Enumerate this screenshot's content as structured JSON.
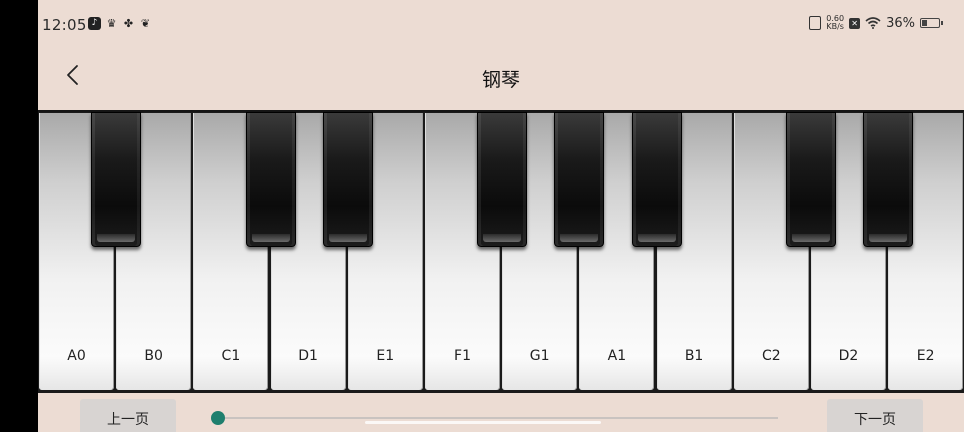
{
  "status_bar": {
    "time": "12:05",
    "left_icons": [
      "tiktok-icon",
      "crown-icon",
      "fan-icon",
      "leaf-icon"
    ],
    "net_speed_value": "0.60",
    "net_speed_unit": "KB/s",
    "battery_text": "36%",
    "battery_level": 0.36
  },
  "header": {
    "title": "钢琴"
  },
  "keyboard": {
    "white_keys": [
      {
        "label": "A0"
      },
      {
        "label": "B0"
      },
      {
        "label": "C1"
      },
      {
        "label": "D1"
      },
      {
        "label": "E1"
      },
      {
        "label": "F1"
      },
      {
        "label": "G1"
      },
      {
        "label": "A1"
      },
      {
        "label": "B1"
      },
      {
        "label": "C2"
      },
      {
        "label": "D2"
      },
      {
        "label": "E2"
      }
    ],
    "black_key_after_white_index": [
      0,
      2,
      3,
      5,
      6,
      7,
      9,
      10
    ]
  },
  "controls": {
    "prev_label": "上一页",
    "next_label": "下一页",
    "slider_value": 0.0
  },
  "colors": {
    "background": "#ecdcd3",
    "accent": "#1e7f6e"
  }
}
